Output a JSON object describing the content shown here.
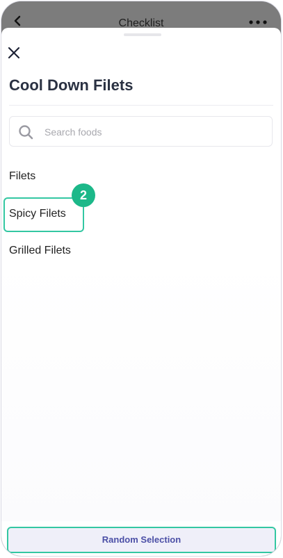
{
  "header": {
    "title": "Checklist"
  },
  "sheet": {
    "title": "Cool Down Filets",
    "search": {
      "placeholder": "Search foods",
      "value": ""
    },
    "foods": [
      {
        "label": "Filets"
      },
      {
        "label": "Spicy Filets"
      },
      {
        "label": "Grilled Filets"
      }
    ],
    "step_badge": "2",
    "random_button": "Random Selection"
  },
  "colors": {
    "accent": "#33c7a2",
    "badge": "#1cb889",
    "button_text": "#4b4fa6",
    "button_bg": "#efeff9"
  }
}
